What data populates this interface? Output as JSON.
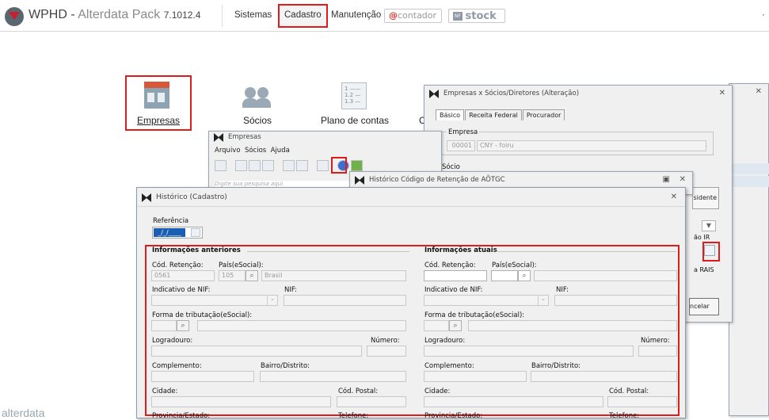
{
  "top": {
    "app_name": "WPHD - ",
    "app_name2": "Alterdata Pack",
    "version": "7.1012.4",
    "menu": [
      "Sistemas",
      "Cadastro",
      "Manutenção"
    ],
    "contador": "contador",
    "contador_at": "@",
    "stock_nf": "NF",
    "stock": "stock",
    "more": "·"
  },
  "modules": {
    "empresas": "Empresas",
    "socios": "Sócios",
    "plano": "Plano de contas",
    "c": "C"
  },
  "socios_window": {
    "title": "Empresas x Sócios/Diretores (Alteração)",
    "tabs": [
      "Básico",
      "Receita Federal",
      "Procurador"
    ],
    "empresa_label": "Empresa",
    "empresa_code": "00001",
    "empresa_name": "CNY - foiru",
    "socio_label": "Sócio",
    "side_labels": [
      "sidente",
      "ão IR",
      "a RAIS",
      "ncelar"
    ]
  },
  "empresas_window": {
    "title": "Empresas",
    "menu": [
      "Arquivo",
      "Sócios",
      "Ajuda"
    ],
    "search_hint": "Digite sua pesquisa aqui"
  },
  "retencao_window": {
    "title": "Histórico Código de Retenção de AÕTGC"
  },
  "historico": {
    "title": "Histórico (Cadastro)",
    "referencia_label": "Referência",
    "referencia_value": "_/_/____",
    "anteriores": {
      "title": "Informações anteriores",
      "cod_retencao_label": "Cód. Retenção:",
      "cod_retencao_value": "0561",
      "pais_label": "País(eSocial):",
      "pais_code": "105",
      "pais_name": "Brasil",
      "nif_ind_label": "Indicativo de NIF:",
      "nif_label": "NIF:",
      "forma_label": "Forma de tributação(eSocial):",
      "logradouro_label": "Logradouro:",
      "numero_label": "Número:",
      "complemento_label": "Complemento:",
      "bairro_label": "Bairro/Distrito:",
      "cidade_label": "Cidade:",
      "cep_label": "Cód. Postal:",
      "provincia_label": "Provincia/Estado:",
      "telefone_label": "Telefone:"
    },
    "atuais": {
      "title": "Informações atuais",
      "cod_retencao_label": "Cód. Retenção:",
      "pais_label": "País(eSocial):",
      "nif_ind_label": "Indicativo de NIF:",
      "nif_label": "NIF:",
      "forma_label": "Forma de tributação(eSocial):",
      "logradouro_label": "Logradouro:",
      "numero_label": "Número:",
      "complemento_label": "Complemento:",
      "bairro_label": "Bairro/Distrito:",
      "cidade_label": "Cidade:",
      "cep_label": "Cód. Postal:",
      "provincia_label": "Provincia/Estado:",
      "telefone_label": "Telefone:"
    }
  },
  "brand": "alterdata",
  "colors": {
    "highlight": "#e01b1b",
    "accent": "#1a5fb4"
  }
}
